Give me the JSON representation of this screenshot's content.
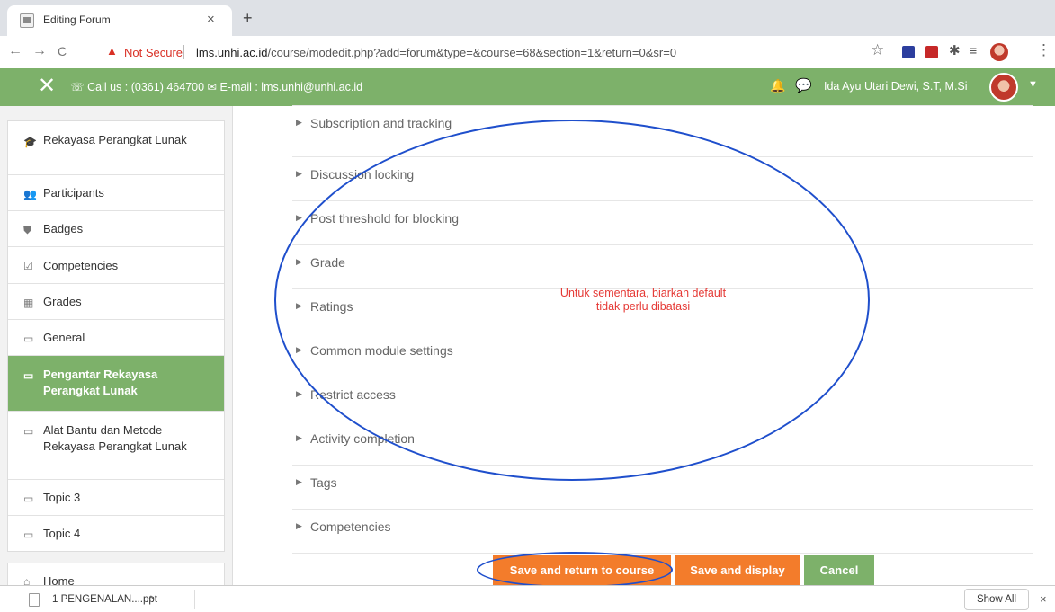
{
  "browser": {
    "tab_title": "Editing Forum",
    "tab_close": "×",
    "new_tab": "+",
    "back": "←",
    "forward": "→",
    "reload": "C",
    "warning_icon": "▲",
    "not_secure": "Not Secure",
    "url_host": "lms.unhi.ac.id",
    "url_path": "/course/modedit.php?add=forum&type=&course=68&section=1&return=0&sr=0",
    "menu": "⋮"
  },
  "navbar": {
    "close": "✕",
    "contact": "☏ Call us : (0361) 464700 ✉ E-mail : lms.unhi@unhi.ac.id",
    "user_name": "Ida Ayu Utari Dewi, S.T, M.Si",
    "bg_color": "#7db16a"
  },
  "sidebar": {
    "items": [
      {
        "icon": "graduation-cap-icon",
        "glyph": "🎓",
        "label": "Rekayasa Perangkat Lunak"
      },
      {
        "icon": "users-icon",
        "glyph": "👥",
        "label": "Participants"
      },
      {
        "icon": "shield-icon",
        "glyph": "🛡",
        "label": "Badges"
      },
      {
        "icon": "checkbox-icon",
        "glyph": "☑",
        "label": "Competencies"
      },
      {
        "icon": "table-icon",
        "glyph": "▦",
        "label": "Grades"
      },
      {
        "icon": "folder-icon",
        "glyph": "▭",
        "label": "General"
      },
      {
        "icon": "folder-icon",
        "glyph": "▭",
        "label": "Pengantar Rekayasa Perangkat Lunak",
        "active": true
      },
      {
        "icon": "folder-icon",
        "glyph": "▭",
        "label": "Alat Bantu dan Metode Rekayasa Perangkat Lunak"
      },
      {
        "icon": "folder-icon",
        "glyph": "▭",
        "label": "Topic 3"
      },
      {
        "icon": "folder-icon",
        "glyph": "▭",
        "label": "Topic 4"
      }
    ],
    "home_label": "Home"
  },
  "main": {
    "sections": [
      "Subscription and tracking",
      "Discussion locking",
      "Post threshold for blocking",
      "Grade",
      "Ratings",
      "Common module settings",
      "Restrict access",
      "Activity completion",
      "Tags",
      "Competencies"
    ],
    "buttons": {
      "save_return": "Save and return to course",
      "save_display": "Save and display",
      "cancel": "Cancel"
    },
    "annotation_note_line1": "Untuk sementara, biarkan default",
    "annotation_note_line2": "tidak perlu dibatasi"
  },
  "download_bar": {
    "file_name": "1 PENGENALAN....ppt",
    "caret": "^",
    "show_all": "Show All",
    "close": "×"
  },
  "colors": {
    "accent_green": "#7db16a",
    "accent_orange": "#f37c2b",
    "annotation_blue": "#1f4fcc",
    "annotation_red": "#e53935"
  }
}
